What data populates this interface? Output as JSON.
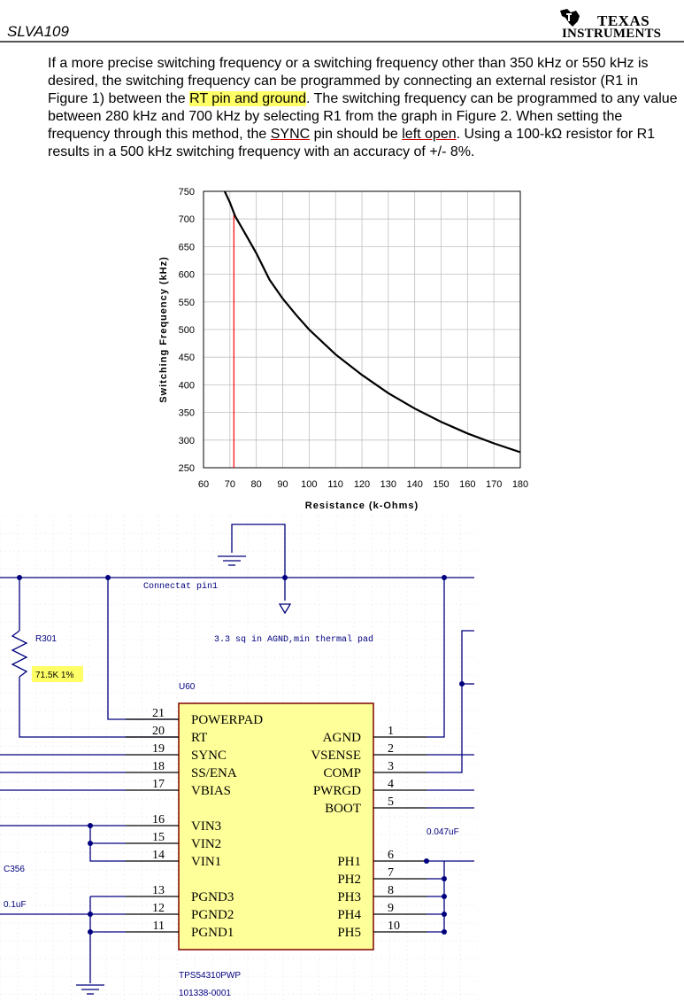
{
  "header": {
    "doc_id": "SLVA109",
    "brand_line1": "Texas",
    "brand_line2": "Instruments"
  },
  "body": {
    "t1": "If a more precise switching frequency or a switching frequency other than 350 kHz or 550 kHz is desired, the switching frequency can be programmed by connecting an external resistor (R1 in Figure 1) between the ",
    "highlight": "RT pin and ground",
    "t2": ". The switching frequency can be programmed to any value between 280 kHz and 700 kHz by selecting R1 from the graph in Figure 2. When setting the frequency through this method, the ",
    "sync": "SYNC",
    "t3": " pin should be ",
    "left_open": "left open",
    "t4": ". Using a 100-kΩ resistor for R1 results in a 500 kHz switching frequency with an accuracy of +/- 8%."
  },
  "chart_data": {
    "type": "line",
    "title": "",
    "xlabel": "Resistance (k-Ohms)",
    "ylabel": "Switching Frequency (kHz)",
    "xlim": [
      60,
      180
    ],
    "ylim": [
      250,
      750
    ],
    "x_ticks": [
      60,
      70,
      80,
      90,
      100,
      110,
      120,
      130,
      140,
      150,
      160,
      170,
      180
    ],
    "y_ticks": [
      250,
      300,
      350,
      400,
      450,
      500,
      550,
      600,
      650,
      700,
      750
    ],
    "grid": true,
    "colors": {
      "curve": "#000000",
      "marker": "#ff0000",
      "grid": "#c0c0c0"
    },
    "series": [
      {
        "x": [
          68,
          70,
          72,
          75,
          78,
          80,
          85,
          90,
          95,
          100,
          110,
          120,
          130,
          140,
          150,
          160,
          170,
          180
        ],
        "y": [
          750,
          730,
          705,
          680,
          655,
          638,
          590,
          556,
          527,
          500,
          455,
          418,
          385,
          357,
          333,
          312,
          294,
          278
        ]
      }
    ],
    "vertical_marker_x": 71.5
  },
  "schematic": {
    "note_connect": "Connectat pin1",
    "note_agnd": "3.3 sq in AGND,min thermal pad",
    "resistor_ref": "R301",
    "resistor_value": "71.5K 1%",
    "ic_ref": "U60",
    "ic_part": "TPS54310PWP",
    "ic_number": "101338-0001",
    "cap_ref": "C356",
    "cap_value": "0.1uF",
    "cap2_value": "0.047uF",
    "highlight_color": "#ffff66",
    "ic_fill": "#ffff99",
    "wire_color": "#00007f",
    "left_pins": [
      {
        "num": "21",
        "name": "POWERPAD"
      },
      {
        "num": "20",
        "name": "RT"
      },
      {
        "num": "19",
        "name": "SYNC"
      },
      {
        "num": "18",
        "name": "SS/ENA"
      },
      {
        "num": "17",
        "name": "VBIAS"
      },
      {
        "num": "16",
        "name": "VIN3"
      },
      {
        "num": "15",
        "name": "VIN2"
      },
      {
        "num": "14",
        "name": "VIN1"
      },
      {
        "num": "13",
        "name": "PGND3"
      },
      {
        "num": "12",
        "name": "PGND2"
      },
      {
        "num": "11",
        "name": "PGND1"
      }
    ],
    "right_pins": [
      {
        "num": "1",
        "name": "AGND"
      },
      {
        "num": "2",
        "name": "VSENSE"
      },
      {
        "num": "3",
        "name": "COMP"
      },
      {
        "num": "4",
        "name": "PWRGD"
      },
      {
        "num": "5",
        "name": "BOOT"
      },
      {
        "num": "6",
        "name": "PH1"
      },
      {
        "num": "7",
        "name": "PH2"
      },
      {
        "num": "8",
        "name": "PH3"
      },
      {
        "num": "9",
        "name": "PH4"
      },
      {
        "num": "10",
        "name": "PH5"
      }
    ]
  }
}
